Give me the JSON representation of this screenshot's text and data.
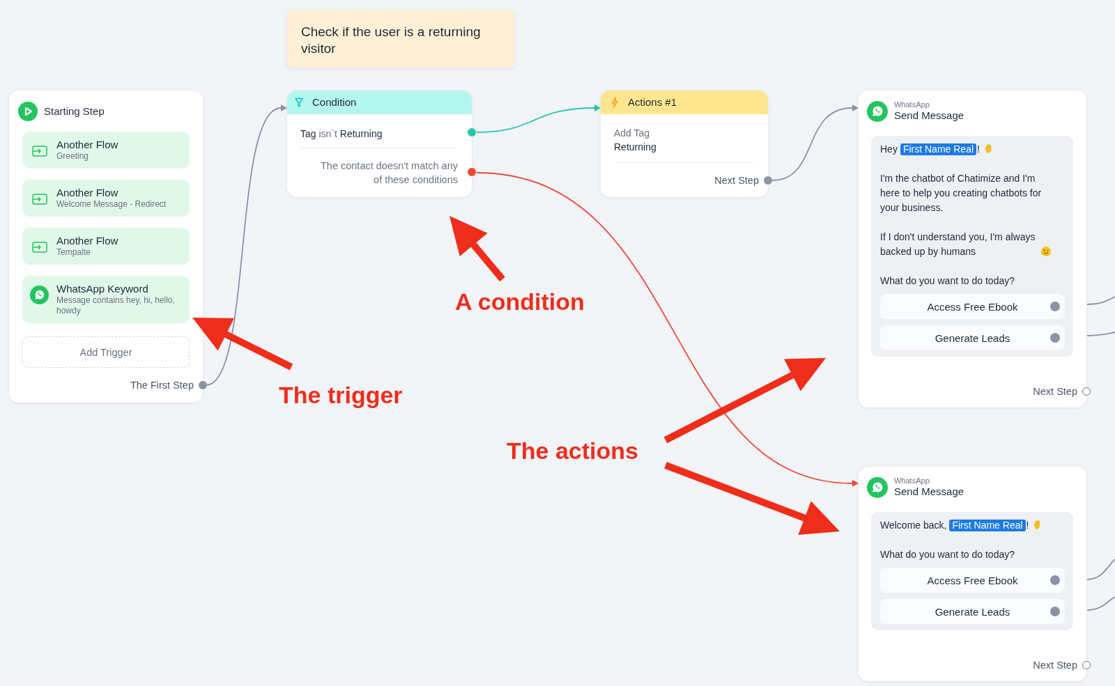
{
  "note": {
    "text": "Check if the user is a returning visitor"
  },
  "start_step": {
    "title": "Starting Step",
    "triggers": [
      {
        "kind": "flow",
        "title": "Another Flow",
        "subtitle": "Greeting"
      },
      {
        "kind": "flow",
        "title": "Another Flow",
        "subtitle": "Welcome Message - Redirect"
      },
      {
        "kind": "flow",
        "title": "Another Flow",
        "subtitle": "Tempalte"
      },
      {
        "kind": "whatsapp",
        "title": "WhatsApp Keyword",
        "subtitle": "Message contains hey, hi, hello, howdy"
      }
    ],
    "add_button": "Add Trigger",
    "output": {
      "label": "The First Step",
      "connected": true
    }
  },
  "condition": {
    "title": "Condition",
    "branches": [
      {
        "kind": "rule",
        "field": "Tag",
        "operator": "isn`t",
        "value": "Returning",
        "color": "#26c9a5"
      },
      {
        "kind": "fallback",
        "text": "The contact doesn't match any of these conditions",
        "color": "#ec4a35"
      }
    ]
  },
  "action": {
    "title": "Actions #1",
    "steps": [
      {
        "label": "Add Tag",
        "value": "Returning"
      }
    ],
    "output": {
      "label": "Next Step",
      "connected": true
    }
  },
  "messages": [
    {
      "channel": "WhatsApp",
      "title": "Send Message",
      "paragraphs": [
        {
          "parts": [
            {
              "kind": "text",
              "text": "Hey"
            },
            {
              "kind": "variable",
              "text": "First Name Real"
            },
            {
              "kind": "text",
              "text": "!"
            },
            {
              "kind": "wave"
            }
          ]
        },
        {
          "parts": [
            {
              "kind": "text",
              "text": "I'm the chatbot of Chatimize and I'm here to help you creating chatbots for your business."
            }
          ]
        },
        {
          "parts": [
            {
              "kind": "text",
              "text": "If I don't understand you, I'm always backed up by humans"
            },
            {
              "kind": "wink"
            }
          ]
        },
        {
          "parts": [
            {
              "kind": "text",
              "text": "What do you want to do today?"
            }
          ]
        }
      ],
      "buttons": [
        {
          "label": "Access Free Ebook",
          "connected": true
        },
        {
          "label": "Generate Leads",
          "connected": true
        }
      ],
      "output": {
        "label": "Next Step",
        "connected": false
      }
    },
    {
      "channel": "WhatsApp",
      "title": "Send Message",
      "paragraphs": [
        {
          "parts": [
            {
              "kind": "text",
              "text": "Welcome back,"
            },
            {
              "kind": "variable",
              "text": "First Name Real"
            },
            {
              "kind": "text",
              "text": "!"
            },
            {
              "kind": "wave"
            }
          ]
        },
        {
          "parts": [
            {
              "kind": "text",
              "text": "What do you want to do today?"
            }
          ]
        }
      ],
      "buttons": [
        {
          "label": "Access Free Ebook",
          "connected": true
        },
        {
          "label": "Generate Leads",
          "connected": true
        }
      ],
      "output": {
        "label": "Next Step",
        "connected": false
      }
    }
  ],
  "annotations": [
    {
      "text": "A condition"
    },
    {
      "text": "The trigger"
    },
    {
      "text": "The actions"
    }
  ]
}
